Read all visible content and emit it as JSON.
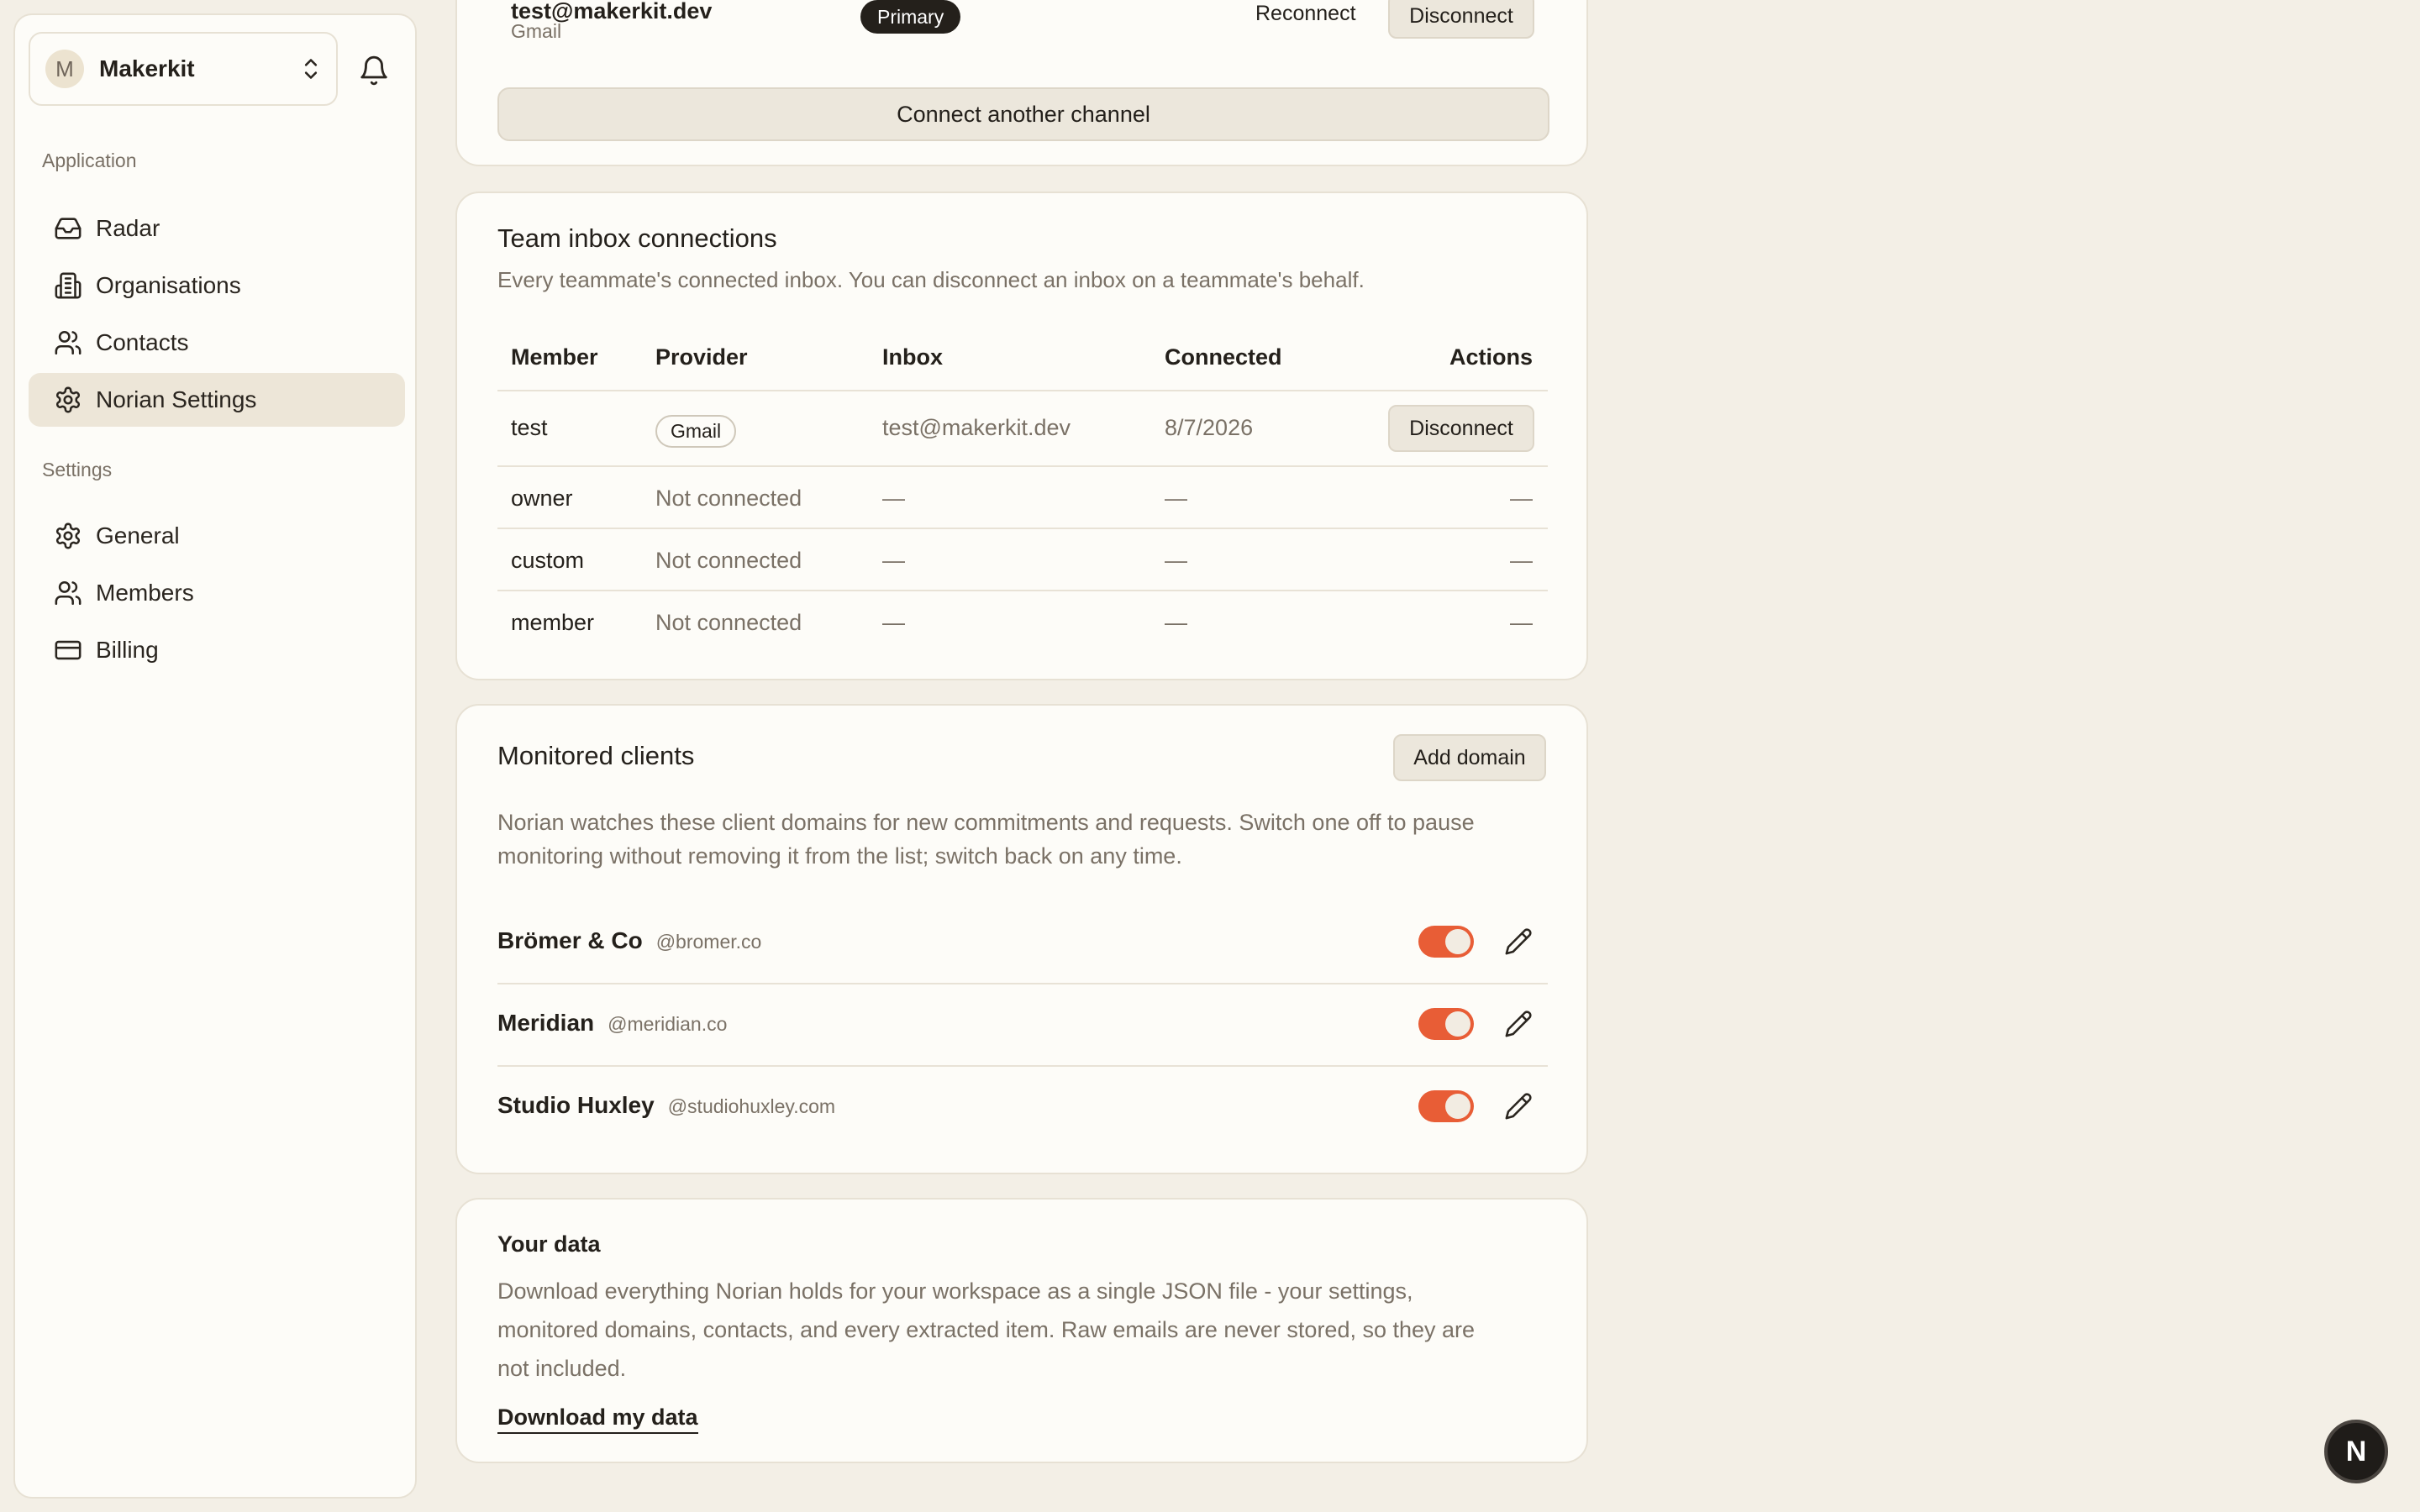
{
  "sidebar": {
    "workspace": {
      "initial": "M",
      "name": "Makerkit"
    },
    "sections": [
      {
        "label": "Application"
      },
      {
        "label": "Settings"
      }
    ],
    "items": [
      {
        "label": "Radar",
        "icon": "inbox-icon"
      },
      {
        "label": "Organisations",
        "icon": "building-icon"
      },
      {
        "label": "Contacts",
        "icon": "users-icon"
      },
      {
        "label": "Norian Settings",
        "icon": "gear-icon",
        "active": true
      },
      {
        "label": "General",
        "icon": "gear-icon"
      },
      {
        "label": "Members",
        "icon": "users-icon"
      },
      {
        "label": "Billing",
        "icon": "credit-card-icon"
      }
    ]
  },
  "channels": {
    "email": "test@makerkit.dev",
    "provider": "Gmail",
    "primary_badge": "Primary",
    "reconnect_label": "Reconnect",
    "disconnect_label": "Disconnect",
    "connect_another_label": "Connect another channel"
  },
  "team_inbox": {
    "title": "Team inbox connections",
    "description": "Every teammate's connected inbox. You can disconnect an inbox on a teammate's behalf.",
    "headers": [
      "Member",
      "Provider",
      "Inbox",
      "Connected",
      "Actions"
    ],
    "rows": [
      {
        "member": "test",
        "provider": "Gmail",
        "inbox": "test@makerkit.dev",
        "connected": "8/7/2026",
        "action": "Disconnect"
      },
      {
        "member": "owner",
        "provider": "Not connected",
        "inbox": "—",
        "connected": "—",
        "action": "—"
      },
      {
        "member": "custom",
        "provider": "Not connected",
        "inbox": "—",
        "connected": "—",
        "action": "—"
      },
      {
        "member": "member",
        "provider": "Not connected",
        "inbox": "—",
        "connected": "—",
        "action": "—"
      }
    ]
  },
  "monitored": {
    "title": "Monitored clients",
    "add_label": "Add domain",
    "description_line1": "Norian watches these client domains for new commitments and requests. Switch one off to pause",
    "description_line2": "monitoring without removing it from the list; switch back on any time.",
    "clients": [
      {
        "name": "Brömer & Co",
        "domain": "@bromer.co",
        "enabled": true
      },
      {
        "name": "Meridian",
        "domain": "@meridian.co",
        "enabled": true
      },
      {
        "name": "Studio Huxley",
        "domain": "@studiohuxley.com",
        "enabled": true
      }
    ]
  },
  "your_data": {
    "title": "Your data",
    "line1": "Download everything Norian holds for your workspace as a single JSON file - your settings,",
    "line2": "monitored domains, contacts, and every extracted item. Raw emails are never stored, so they are",
    "line3": "not included.",
    "link_label": "Download my data"
  },
  "fab": {
    "label": "N"
  },
  "colors": {
    "accent": "#e85d36",
    "background": "#f3efe6",
    "card": "#fdfcf8",
    "active_nav": "#ede6d8"
  }
}
